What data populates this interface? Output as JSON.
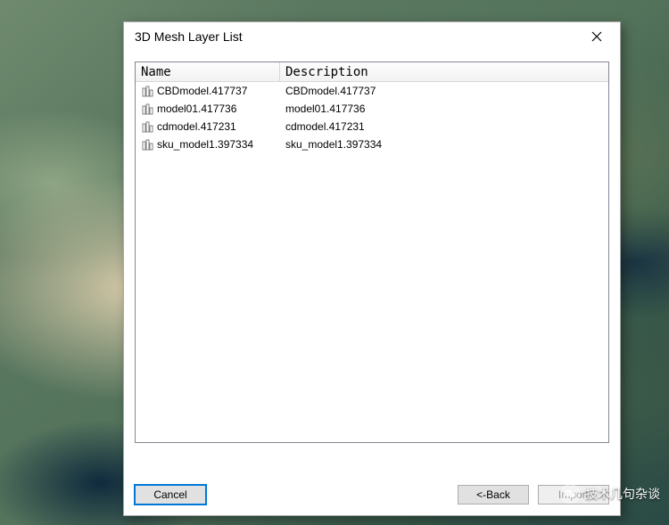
{
  "dialog": {
    "title": "3D Mesh Layer List",
    "columns": {
      "name": "Name",
      "desc": "Description"
    },
    "rows": [
      {
        "name": "CBDmodel.417737",
        "description": "CBDmodel.417737"
      },
      {
        "name": "model01.417736",
        "description": "model01.417736"
      },
      {
        "name": "cdmodel.417231",
        "description": "cdmodel.417231"
      },
      {
        "name": "sku_model1.397334",
        "description": "sku_model1.397334"
      }
    ],
    "buttons": {
      "cancel": "Cancel",
      "back": "<-Back",
      "import": "Import"
    }
  },
  "watermark": {
    "text": "技术几句杂谈"
  }
}
